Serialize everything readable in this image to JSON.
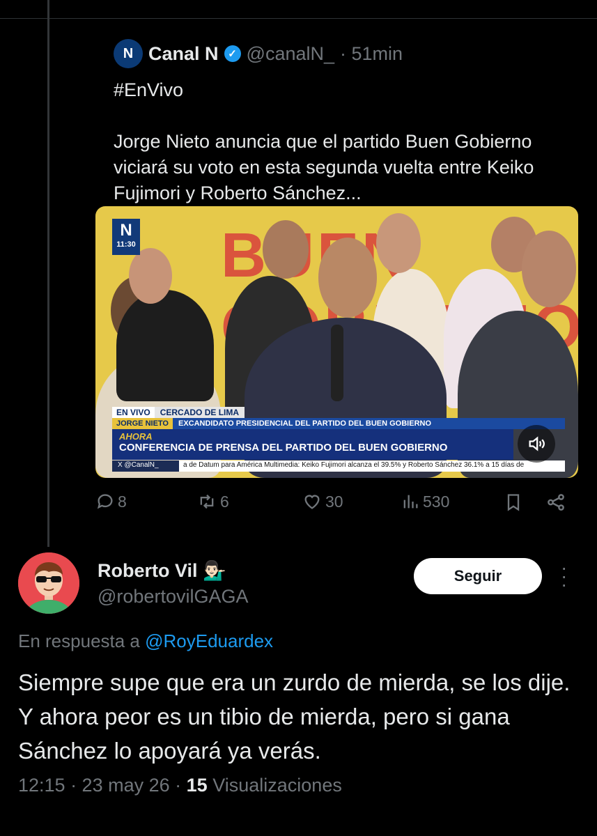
{
  "quoted_tweet": {
    "logo_text": "N",
    "name": "Canal N",
    "handle": "@canalN_",
    "time": "· 51min",
    "text": "#EnVivo\n\nJorge Nieto anuncia que el partido Buen Gobierno viciará su voto en esta segunda vuelta entre Keiko Fujimori y Roberto Sánchez...",
    "media": {
      "logo_letter": "N",
      "time": "11:30",
      "live_tag": "EN VIVO",
      "location": "CERCADO DE LIMA",
      "person": "JORGE NIETO",
      "role": "EXCANDIDATO PRESIDENCIAL DEL PARTIDO DEL BUEN GOBIERNO",
      "now_label": "AHORA",
      "headline": "CONFERENCIA DE PRENSA DEL PARTIDO DEL BUEN GOBIERNO",
      "x_handle": "X @CanalN_",
      "ticker": "a de Datum para América Multimedia: Keiko Fujimori alcanza el 39.5% y Roberto Sánchez 36.1% a 15 días de"
    }
  },
  "actions": {
    "replies": "8",
    "reposts": "6",
    "likes": "30",
    "views": "530"
  },
  "reply": {
    "name": "Roberto Vil 💁🏻‍♂️",
    "handle": "@robertovilGAGA",
    "follow_label": "Seguir",
    "reply_prefix": "En respuesta a",
    "reply_to": "@RoyEduardex",
    "text": "Siempre supe que era un zurdo de mierda, se los dije. Y ahora peor es un tibio de mierda, pero si gana Sánchez lo apoyará ya verás.",
    "time": "12:15 · 23 may 26 ·",
    "views_count": "15",
    "views_label": "Visualizaciones"
  },
  "colors": {
    "accent": "#1d9bf0",
    "muted": "#71767b",
    "text": "#e7e9ea",
    "background": "#000000"
  }
}
